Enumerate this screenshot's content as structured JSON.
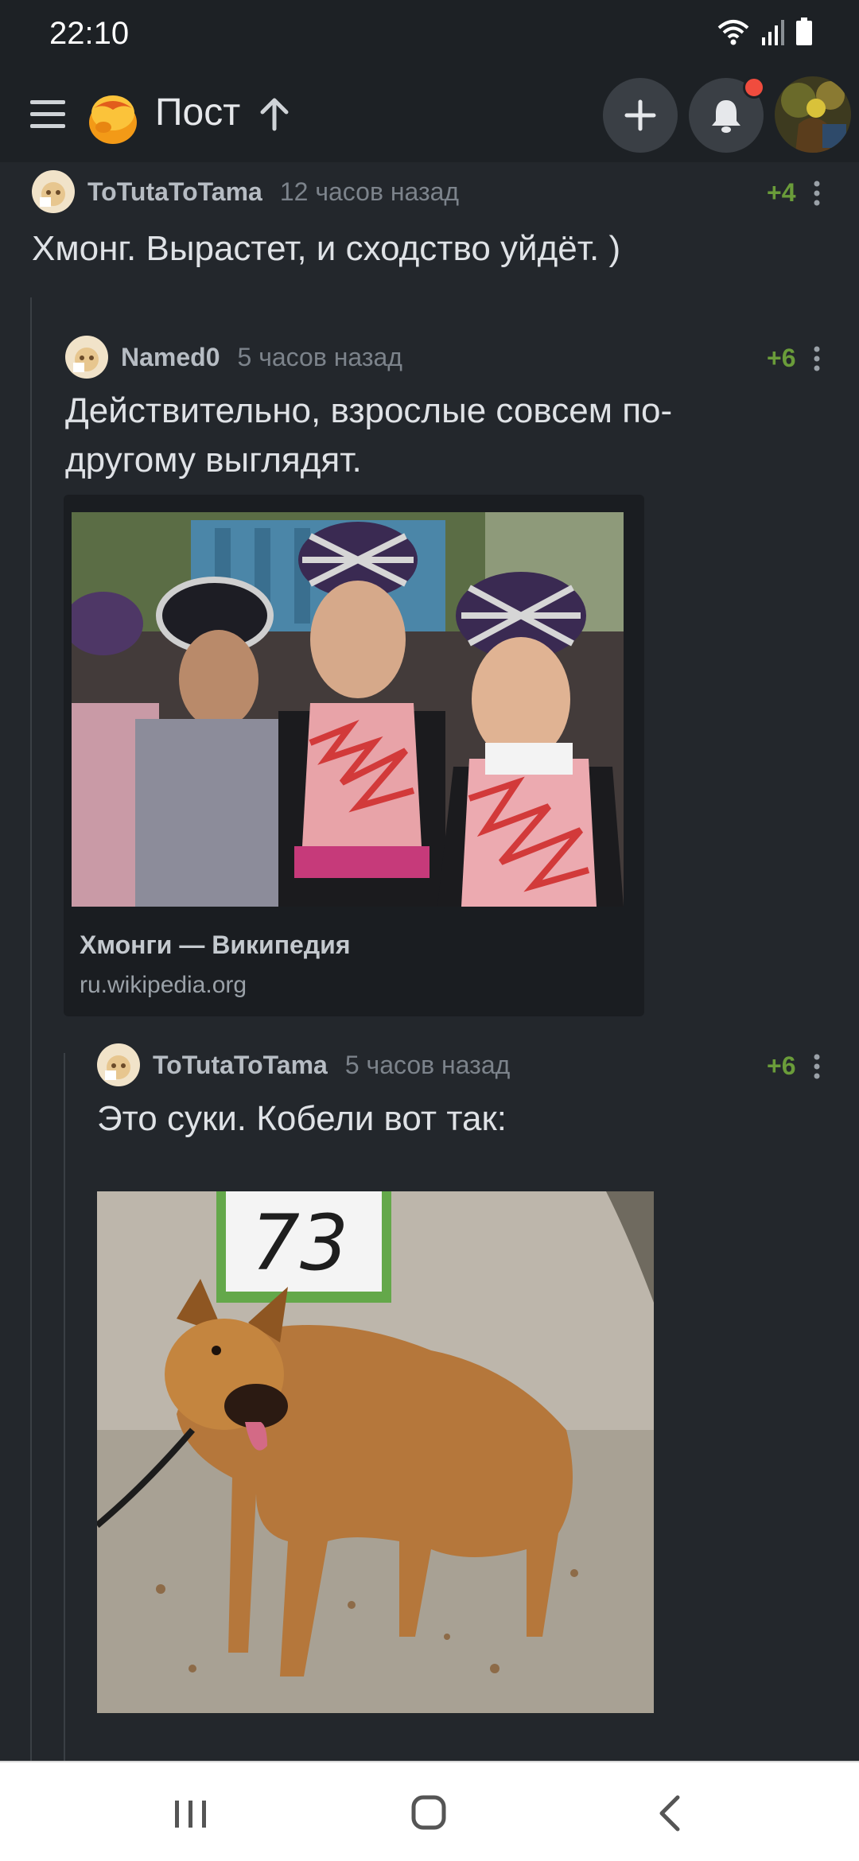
{
  "status_bar": {
    "time": "22:10"
  },
  "header": {
    "title": "Пост"
  },
  "comments": [
    {
      "user": "ToTutaToTama",
      "time": "12 часов назад",
      "rating": "+4",
      "text": "Хмонг. Вырастет, и сходство уйдёт. )"
    },
    {
      "user": "Named0",
      "time": "5 часов назад",
      "rating": "+6",
      "text_line1": "Действительно, взрослые совсем по-",
      "text_line2": "другому выглядят.",
      "link": {
        "title": "Хмонги — Википедия",
        "domain": "ru.wikipedia.org"
      }
    },
    {
      "user": "ToTutaToTama",
      "time": "5 часов назад",
      "rating": "+6",
      "text": "Это суки. Кобели вот так:",
      "image_sign": "73"
    }
  ],
  "colors": {
    "background": "#23272c",
    "header": "#1d2125",
    "rating": "#6a9c3a",
    "notification": "#f04c3e"
  },
  "icons": [
    "menu-icon",
    "pikabu-logo-icon",
    "arrow-up-icon",
    "plus-icon",
    "bell-icon",
    "more-icon",
    "recent-apps-icon",
    "home-icon",
    "back-icon"
  ]
}
